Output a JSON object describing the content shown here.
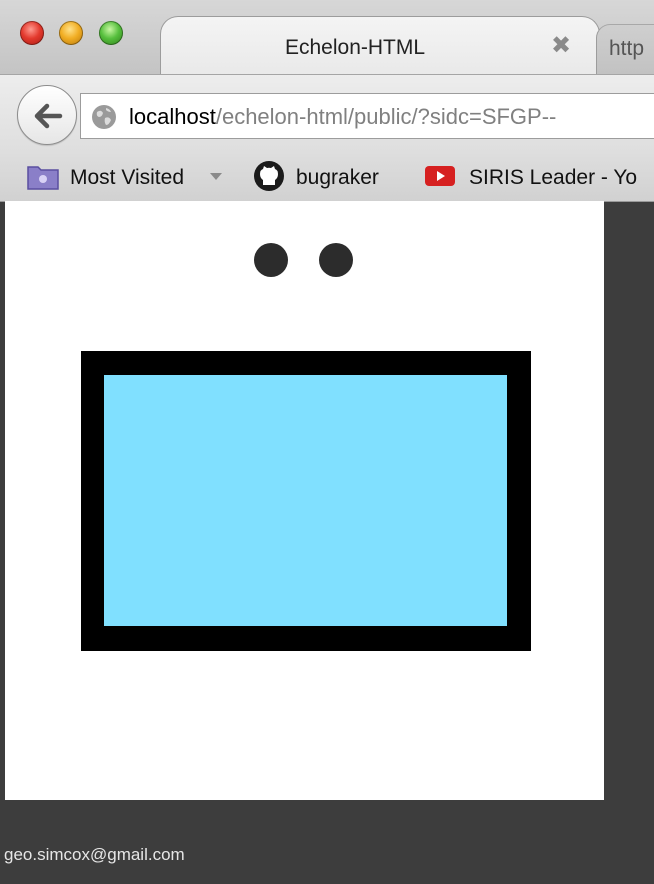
{
  "browser": {
    "active_tab": {
      "title": "Echelon-HTML"
    },
    "inactive_tab": {
      "title": "http"
    },
    "url": {
      "host": "localhost",
      "path": "/echelon-html/public/?sidc=SFGP--"
    },
    "bookmarks": [
      {
        "label": "Most Visited",
        "icon": "folder-icon"
      },
      {
        "label": "bugraker",
        "icon": "github-icon"
      },
      {
        "label": "SIRIS Leader - Yo",
        "icon": "youtube-icon"
      }
    ]
  },
  "page": {
    "symbol": {
      "frame_color": "#000000",
      "fill_color": "#80e0ff",
      "dot_color": "#2c2c2c",
      "indicator_dots": 2
    }
  },
  "footer": {
    "email": "geo.simcox@gmail.com"
  },
  "colors": {
    "outer_background": "#3d3d3d",
    "page_background": "#ffffff"
  }
}
